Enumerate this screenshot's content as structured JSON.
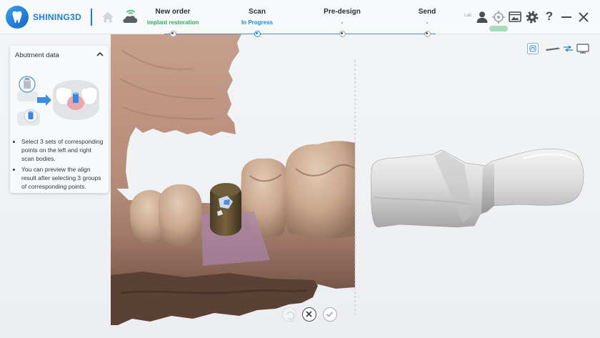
{
  "brand": {
    "name": "SHINING3D"
  },
  "header": {
    "steps": [
      {
        "label": "New order",
        "status": "implant restoration"
      },
      {
        "label": "Scan",
        "status": "In Progress"
      },
      {
        "label": "Pre-design",
        "status": "-"
      },
      {
        "label": "Send",
        "status": "-"
      }
    ],
    "lab_label": "Lab",
    "help_glyph": "?"
  },
  "panel": {
    "title": "Abutment data",
    "instructions": [
      "Select 3 sets of corresponding points on the left and right scan bodies.",
      "You can preview the align result after selecting 3 groups of corresponding points."
    ]
  },
  "icons": {
    "logo": "shining3d-logo-icon",
    "home": "home-icon",
    "cloud": "cloud-wifi-icon",
    "user": "user-icon",
    "target": "crosshair-icon",
    "capture": "screen-capture-icon",
    "settings": "gear-icon",
    "help": "help-icon",
    "minimize": "minimize-icon",
    "close": "close-icon",
    "collapse": "chevron-up-icon",
    "view_tool": "scan-view-icon",
    "device": "scanner-pc-connection-icon",
    "cancel": "close-circle-icon",
    "confirm": "check-circle-icon"
  },
  "colors": {
    "brand_blue": "#1a7fd6",
    "status_done": "#27ae60",
    "status_active": "#1e88e5",
    "progress_line": "#3a8ee6",
    "status_online": "#a6dcbc"
  }
}
